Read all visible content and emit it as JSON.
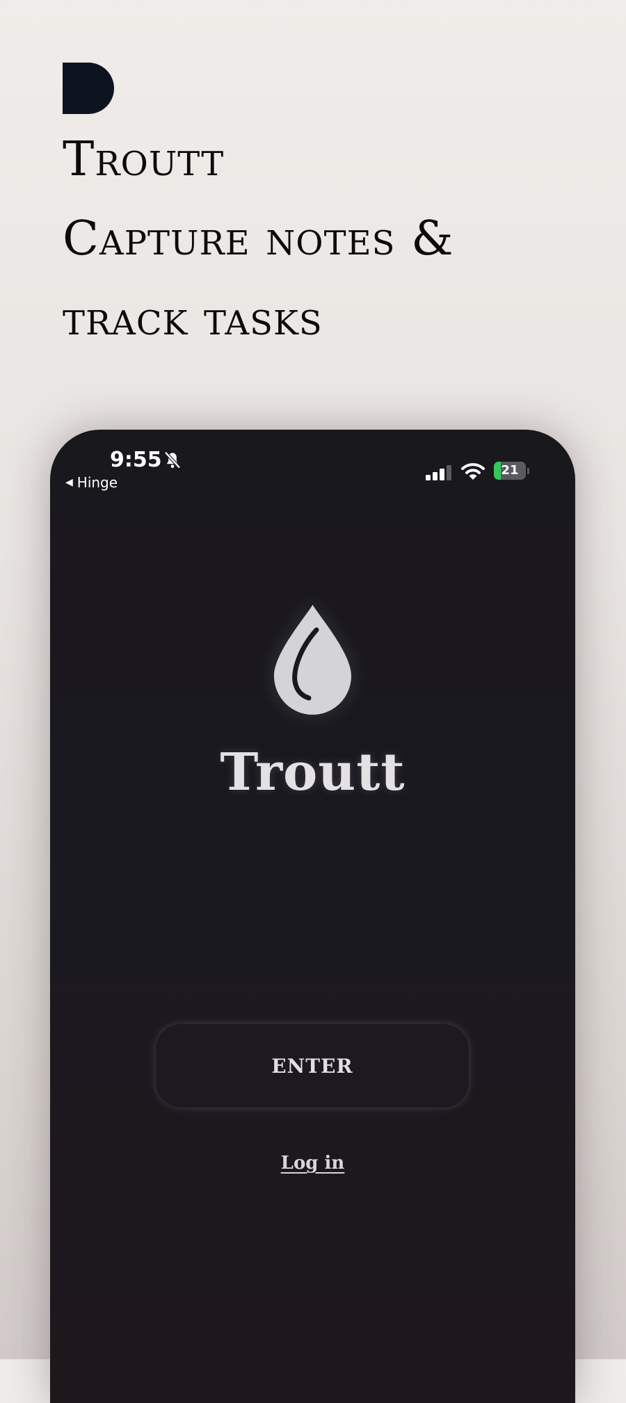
{
  "marketing": {
    "title": "Troutt",
    "tagline_line1": "Capture notes &",
    "tagline_line2": "track tasks"
  },
  "status_bar": {
    "time": "9:55",
    "back_app": "Hinge",
    "battery_percent": "21",
    "battery_level": 0.21,
    "icons": [
      "bell-slash-icon",
      "signal-icon",
      "wifi-icon",
      "battery-charging-icon"
    ]
  },
  "app": {
    "logo_icon": "water-drop-icon",
    "name": "Troutt",
    "enter_label": "ENTER",
    "login_label": "Log in"
  },
  "colors": {
    "page_background": "#ebe7e4",
    "logo_mark": "#0e1320",
    "phone_background": "#1a181d",
    "app_text": "#e3e1e4",
    "battery_green": "#34c759"
  }
}
